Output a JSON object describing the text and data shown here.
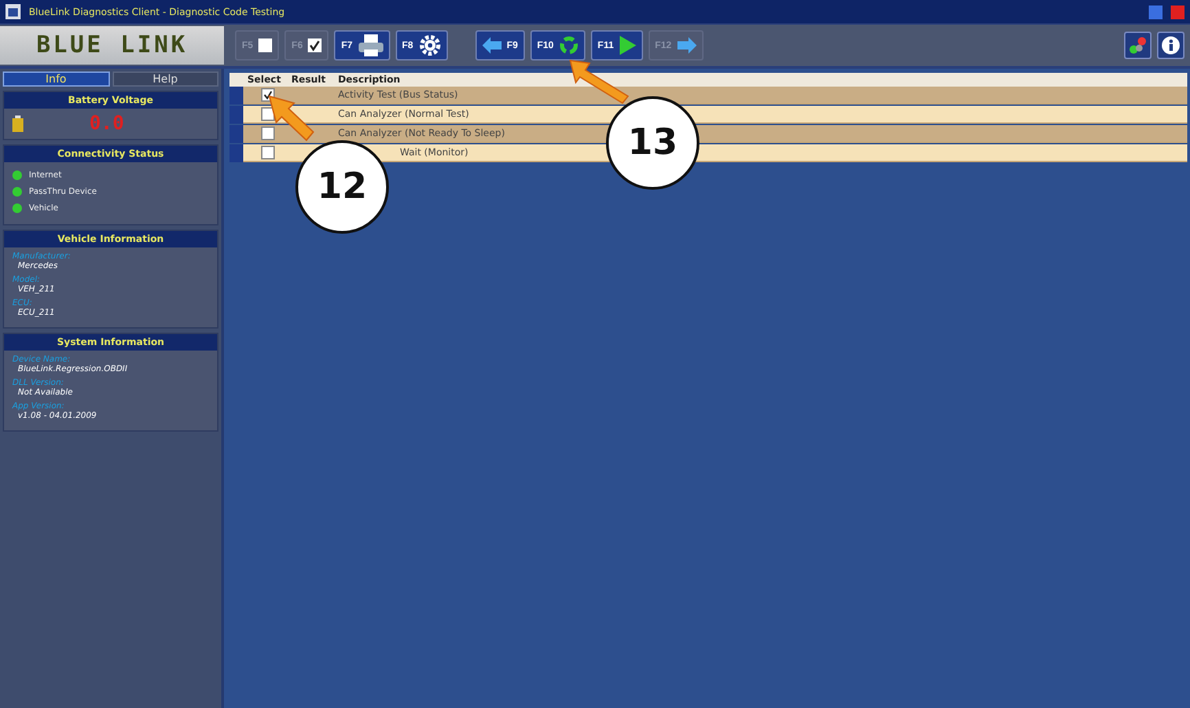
{
  "window": {
    "title": "BlueLink Diagnostics Client  -  Diagnostic Code Testing"
  },
  "logo": "BLUE LINK",
  "toolbar": [
    {
      "key": "F5",
      "kind": "box",
      "disabled": true
    },
    {
      "key": "F6",
      "kind": "checkbox",
      "disabled": true
    },
    {
      "key": "F7",
      "kind": "printer",
      "disabled": false
    },
    {
      "key": "F8",
      "kind": "gear",
      "disabled": false
    },
    {
      "key": "F9",
      "kind": "back",
      "disabled": false
    },
    {
      "key": "F10",
      "kind": "recycle",
      "disabled": false
    },
    {
      "key": "F11",
      "kind": "play",
      "disabled": false
    },
    {
      "key": "F12",
      "kind": "forward",
      "disabled": true
    }
  ],
  "tabs": [
    {
      "label": "Info",
      "selected": true
    },
    {
      "label": "Help",
      "selected": false
    }
  ],
  "battery": {
    "title": "Battery Voltage",
    "reading": "0.0"
  },
  "connectivity": {
    "title": "Connectivity Status",
    "items": [
      "Internet",
      "PassThru Device",
      "Vehicle"
    ]
  },
  "vehicle": {
    "title": "Vehicle Information",
    "fields": [
      {
        "label": "Manufacturer:",
        "value": "Mercedes"
      },
      {
        "label": "Model:",
        "value": "VEH_211"
      },
      {
        "label": "ECU:",
        "value": "ECU_211"
      }
    ]
  },
  "system": {
    "title": "System Information",
    "fields": [
      {
        "label": "Device Name:",
        "value": "BlueLink.Regression.OBDII"
      },
      {
        "label": "DLL Version:",
        "value": "Not Available"
      },
      {
        "label": "App Version:",
        "value": "v1.08 - 04.01.2009"
      }
    ]
  },
  "table": {
    "columns": [
      "Select",
      "Result",
      "Description"
    ],
    "rows": [
      {
        "checked": true,
        "description": "Activity Test (Bus Status)"
      },
      {
        "checked": false,
        "description": "Can Analyzer (Normal Test)"
      },
      {
        "checked": false,
        "description": "Can Analyzer (Not Ready To Sleep)"
      },
      {
        "checked": false,
        "description": "Wait (Monitor)"
      }
    ]
  },
  "callouts": [
    "12",
    "13"
  ]
}
